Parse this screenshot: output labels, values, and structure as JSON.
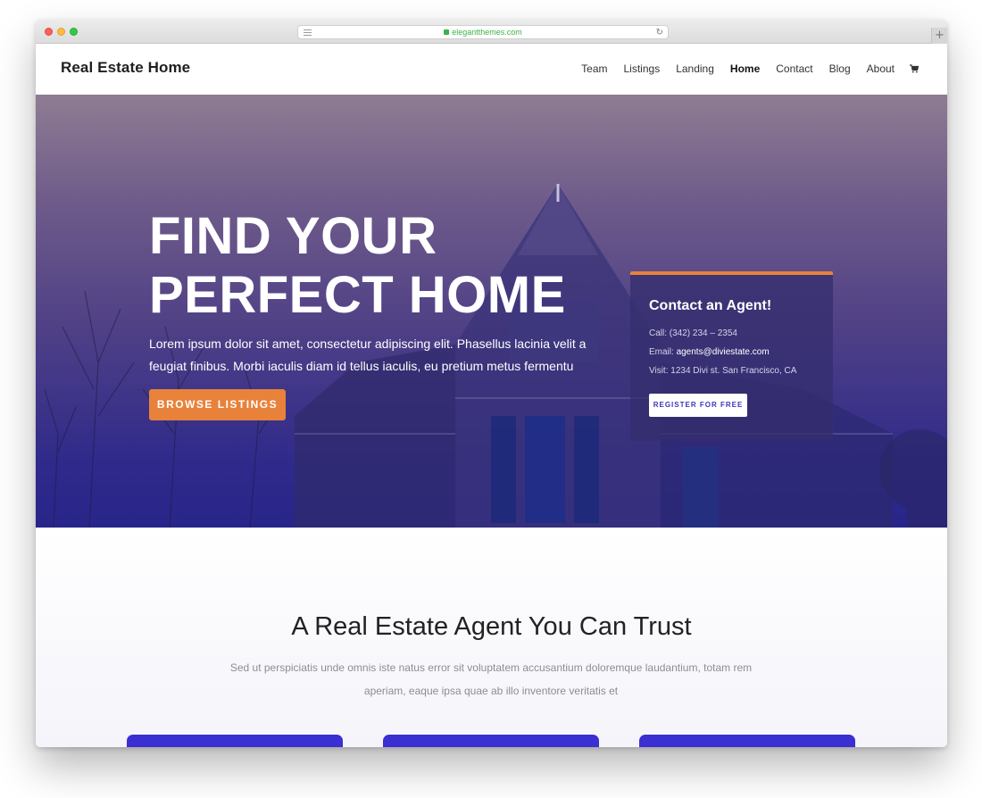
{
  "browser": {
    "url": "elegantthemes.com"
  },
  "header": {
    "logo": "Real Estate Home",
    "nav": [
      "Team",
      "Listings",
      "Landing",
      "Home",
      "Contact",
      "Blog",
      "About"
    ],
    "active_nav": "Home"
  },
  "hero": {
    "title_line1": "FIND YOUR",
    "title_line2": "PERFECT HOME",
    "text": "Lorem ipsum dolor sit amet, consectetur adipiscing elit. Phasellus lacinia velit a feugiat finibus. Morbi iaculis diam id tellus iaculis, eu pretium metus fermentu",
    "button_label": "BROWSE LISTINGS"
  },
  "agent_card": {
    "title": "Contact an Agent!",
    "call_label": "Call: (342) 234 – 2354",
    "email_prefix": "Email: ",
    "email": "agents@diviestate.com",
    "visit_label": "Visit: 1234 Divi st. San Francisco, CA",
    "button_label": "REGISTER FOR FREE"
  },
  "trust": {
    "title": "A Real Estate Agent You Can Trust",
    "text": "Sed ut perspiciatis unde omnis iste natus error sit voluptatem accusantium doloremque laudantium, totam rem aperiam, eaque ipsa quae ab illo inventore veritatis et"
  },
  "colors": {
    "accent_orange": "#e8823a",
    "hero_overlay": "#2f2a8a",
    "card_blue": "#3a2fd0"
  },
  "icons": [
    "lock-icon",
    "reader-icon",
    "reload-icon",
    "cart-icon"
  ]
}
